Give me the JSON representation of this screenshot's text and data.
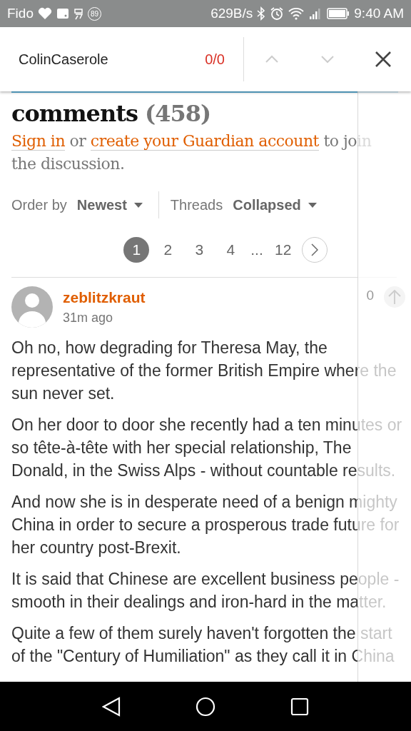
{
  "status_bar": {
    "carrier": "Fido",
    "badge": "89",
    "net_speed": "629B/s",
    "time": "9:40 AM"
  },
  "find_bar": {
    "query": "ColinCaserole",
    "match_count": "0/0"
  },
  "discussion": {
    "heading": "comments",
    "count": "(458)",
    "prompt": {
      "sign_in": "Sign in",
      "or": "or",
      "create_account": "create your Guardian account",
      "rest": "to join the discussion."
    },
    "order_by": {
      "label": "Order by",
      "value": "Newest"
    },
    "threads": {
      "label": "Threads",
      "value": "Collapsed"
    },
    "pages": [
      {
        "label": "1",
        "selected": true
      },
      {
        "label": "2",
        "selected": false
      },
      {
        "label": "3",
        "selected": false
      },
      {
        "label": "4",
        "selected": false
      }
    ],
    "ellipsis": "...",
    "last_page": "12"
  },
  "comment": {
    "author": "zeblitzkraut",
    "time": "31m ago",
    "votes": "0",
    "paragraphs": [
      "Oh no, how degrading for Theresa May, the representative of the former British Empire where the sun never set.",
      "On her door to door she recently had a ten minutes or so tête-à-tête with her special relationship, The Donald, in the Swiss Alps - without countable results.",
      "And now she is in desperate need of a benign mighty China in order to secure a prosperous trade future for her country post-Brexit.",
      "It is said that Chinese are excellent business people - smooth in their dealings and iron-hard in the matter.",
      "Quite a few of them surely haven't forgotten the start of the \"Century of Humiliation\" as they call it in China"
    ]
  }
}
